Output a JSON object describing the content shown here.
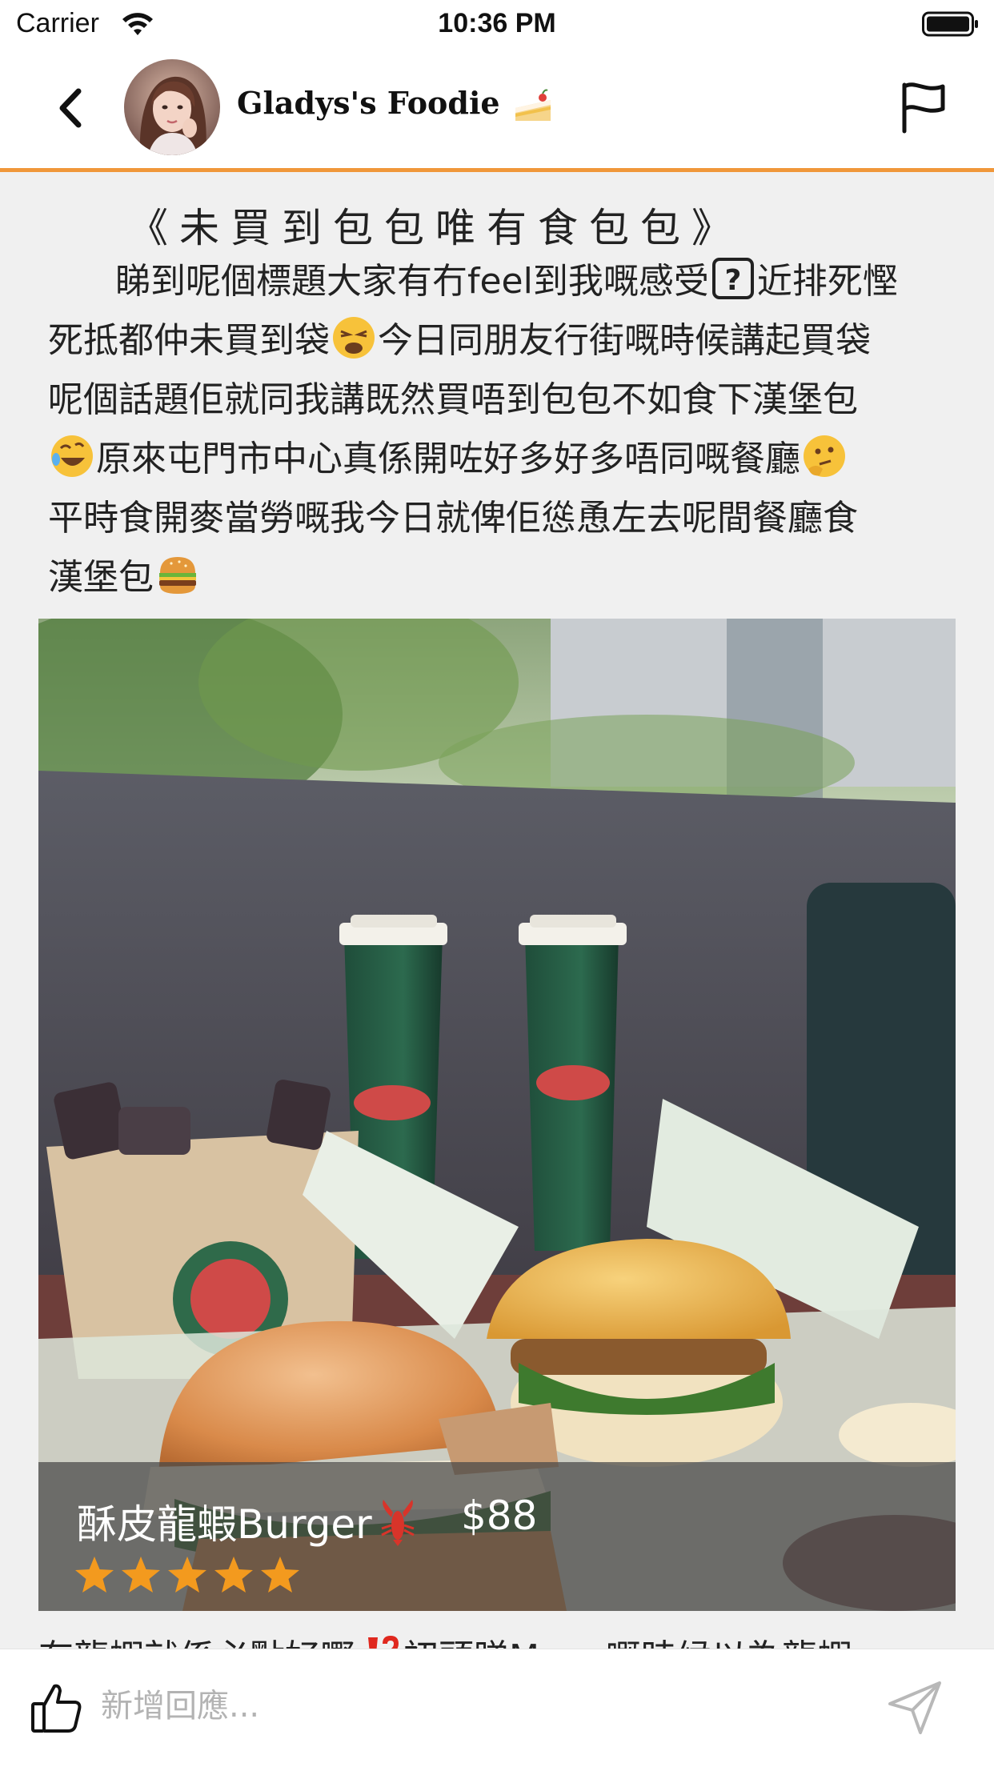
{
  "status_bar": {
    "carrier": "Carrier",
    "time": "10:36 PM"
  },
  "header": {
    "title": "Gladys's Foodie",
    "title_emoji": "cake-icon",
    "accent_color": "#f0973a"
  },
  "post": {
    "title": "《未買到包包唯有食包包》",
    "body_lines": [
      "睇到呢個標題大家有冇feel到我嘅感受",
      "近排死慳",
      "死抵都仲未買到袋",
      "今日同朋友行街嘅時候講起買袋",
      "呢個話題佢就同我講既然買唔到包包不如食下漢堡包",
      "原來屯門市中心真係開咗好多好多唔同嘅餐廳",
      "平時食開麥當勞嘅我今日就俾佢慫恿左去呢間餐廳食",
      "漢堡包"
    ],
    "next_line_partial": "有龍蝦就係必點好嘢",
    "next_line_tail": "初頭睇Menu嘅時候以為龍蝦"
  },
  "photo": {
    "item_name": "酥皮龍蝦Burger",
    "item_price": "$88",
    "rating": 5,
    "rating_color": "#f39a1e"
  },
  "bottom_bar": {
    "comment_placeholder": "新增回應..."
  }
}
